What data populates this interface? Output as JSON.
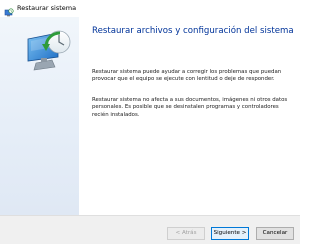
{
  "window": {
    "title": "Restaurar sistema"
  },
  "content": {
    "heading": "Restaurar archivos y configuración del sistema",
    "paragraph1": "Restaurar sistema puede ayudar a corregir los problemas que puedan\nprovocar que el equipo se ejecute con lentitud o deje de responder.",
    "paragraph2": "Restaurar sistema no afecta a sus documentos, imágenes ni otros datos\npersonales. Es posible que se desinstalen programas y controladores\nrecién instalados."
  },
  "buttons": {
    "back_label": "< Atrás",
    "next_label": "Siguiente >",
    "cancel_label": "Cancelar"
  },
  "icons": {
    "title_icon": "system-restore-icon",
    "hero_icon": "system-restore-hero-icon"
  },
  "colors": {
    "heading": "#003399",
    "accent": "#0078d7"
  }
}
